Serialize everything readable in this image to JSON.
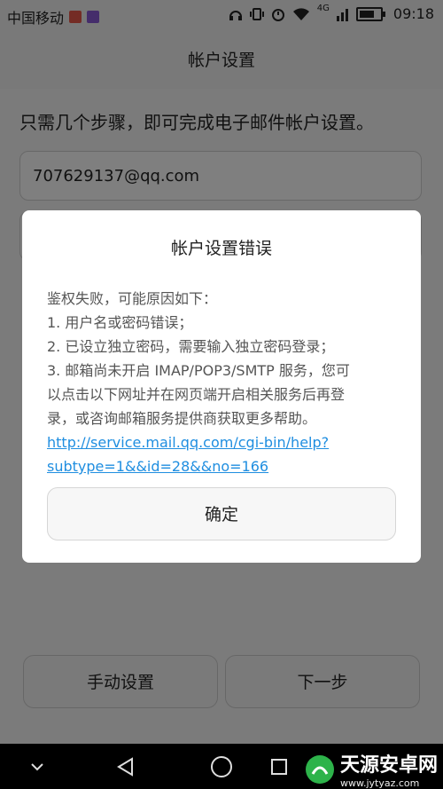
{
  "status_bar": {
    "carrier": "中国移动",
    "network": "4G",
    "time": "09:18",
    "icons": [
      "mail-notification-icon",
      "image-notification-icon",
      "headphones-icon",
      "vibrate-icon",
      "alarm-icon",
      "wifi-icon",
      "signal-icon",
      "battery-icon"
    ],
    "colors": {
      "mail": "#e8584b",
      "image": "#8a5ad6"
    }
  },
  "header": {
    "title": "帐户设置"
  },
  "main": {
    "intro": "只需几个步骤，即可完成电子邮件帐户设置。",
    "email_value": "707629137@qq.com",
    "manual_button": "手动设置",
    "next_button": "下一步"
  },
  "dialog": {
    "title": "帐户设置错误",
    "lines": [
      "鉴权失败，可能原因如下：",
      "1. 用户名或密码错误；",
      "2. 已设立独立密码，需要输入独立密码登录；",
      "3. 邮箱尚未开启 IMAP/POP3/SMTP 服务，您可",
      "以点击以下网址并在网页端开启相关服务后再登",
      "录，或咨询邮箱服务提供商获取更多帮助。"
    ],
    "link_line1": "http://service.mail.qq.com/cgi-bin/help?",
    "link_line2": "subtype=1&&id=28&&no=166",
    "ok_button": "确定",
    "link_color": "#1f8ee0"
  },
  "nav_bar": {
    "icons": [
      "collapse-icon",
      "back-icon",
      "home-icon",
      "recents-icon"
    ]
  },
  "watermark": {
    "name": "天源安卓网",
    "url": "www.jytyaz.com"
  }
}
